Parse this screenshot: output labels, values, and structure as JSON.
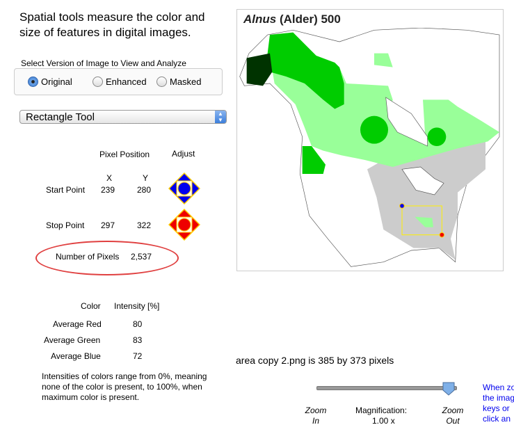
{
  "intro": "Spatial tools measure the color and size of features in digital images.",
  "version": {
    "label": "Select Version of Image to View and Analyze",
    "options": [
      "Original",
      "Enhanced",
      "Masked"
    ],
    "selected": "Original"
  },
  "tool": {
    "selected": "Rectangle Tool"
  },
  "pixel": {
    "header": "Pixel Position",
    "adjust": "Adjust",
    "x": "X",
    "y": "Y",
    "start": {
      "label": "Start Point",
      "x": "239",
      "y": "280"
    },
    "stop": {
      "label": "Stop Point",
      "x": "297",
      "y": "322"
    },
    "count_label": "Number of Pixels",
    "count": "2,537"
  },
  "color": {
    "header_color": "Color",
    "header_intensity": "Intensity [%]",
    "rows": [
      {
        "label": "Average Red",
        "value": "80"
      },
      {
        "label": "Average Green",
        "value": "83"
      },
      {
        "label": "Average Blue",
        "value": "72"
      }
    ],
    "note": "Intensities of colors range from 0%, meaning none of the color is present, to 100%, when maximum color is present."
  },
  "map": {
    "title_genus": "Alnus",
    "title_rest": " (Alder) 500",
    "colors": {
      "dark": "#003300",
      "medium": "#00cc00",
      "light": "#99ff99",
      "gray": "#cccccc",
      "selection": "#ffee00"
    }
  },
  "image_info": "area copy 2.png is 385 by 373 pixels",
  "zoom": {
    "in": "Zoom In",
    "out": "Zoom Out",
    "mag_label": "Magnification:",
    "mag_value": "1.00 x",
    "slider_value": 1.0
  },
  "help": [
    "When zo",
    "the imag",
    "keys or",
    "click an"
  ]
}
